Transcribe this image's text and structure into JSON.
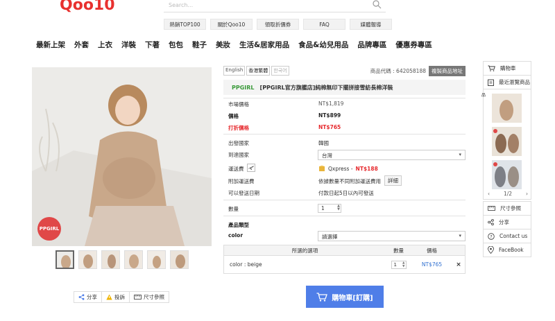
{
  "header": {
    "logo_text": "Qoo10",
    "search_placeholder": "Search...",
    "top_links": [
      "熱銷TOP100",
      "關於Qoo10",
      "領取折價券",
      "FAQ",
      "媒體報導"
    ]
  },
  "category_nav": [
    "最新上架",
    "外套",
    "上衣",
    "洋裝",
    "下著",
    "包包",
    "鞋子",
    "美妝",
    "生活&居家用品",
    "食品&幼兒用品",
    "品牌專區",
    "優惠券專區"
  ],
  "gallery": {
    "badge": "PPGIRL",
    "thumb_count": 6,
    "share_label": "分享",
    "report_label": "投訴",
    "size_label": "尺寸參照"
  },
  "product": {
    "languages": [
      "English",
      "香港繁體",
      "한국어"
    ],
    "code_label": "商品代碼 : 642058188",
    "copy_address_label": "複製商品地址",
    "shop_name": "PPGIRL",
    "title": "[PPGIRL官方旗艦店]純棉無印下擺拼接雪紡長棉洋裝",
    "market_price_label": "市場價格",
    "market_price": "NT$1,819",
    "price_label": "價格",
    "price": "NT$899",
    "discount_label": "打折價格",
    "discount_price": "NT$765",
    "origin_label": "出發國家",
    "origin": "韓國",
    "dest_label": "到達國家",
    "dest": "台灣",
    "shipping_label": "運送費",
    "shipping_method": "Qxpress - ",
    "shipping_fee": "NT$188",
    "extra_label": "附加運送費",
    "extra_value": "依據數量不同附加運送費用",
    "detail_button": "詳細",
    "ship_date_label": "可以發送日期",
    "ship_date": "付款日起5日以內可發送",
    "qty_label": "數量",
    "qty_value": "1",
    "product_type_label": "產品類型",
    "color_label": "color",
    "color_select": "請選擇"
  },
  "options_table": {
    "headers": [
      "所選的選項",
      "數量",
      "價格"
    ],
    "rows": [
      {
        "option": "color : beige",
        "qty": "1",
        "price": "NT$765",
        "remove": "×"
      }
    ]
  },
  "buy_button": "購物車[訂購]",
  "sidebar": {
    "cart": "購物車",
    "recent": "最近瀏覽商品",
    "pager": "1/2",
    "size": "尺寸參照",
    "share": "分享",
    "contact": "Contact us",
    "facebook": "FaceBook",
    "side_char": "品"
  },
  "colors": {
    "accent_red": "#e6282c",
    "button_blue": "#4f7ee8",
    "shop_green": "#3a9a3a",
    "price_blue": "#2f6fd0"
  }
}
